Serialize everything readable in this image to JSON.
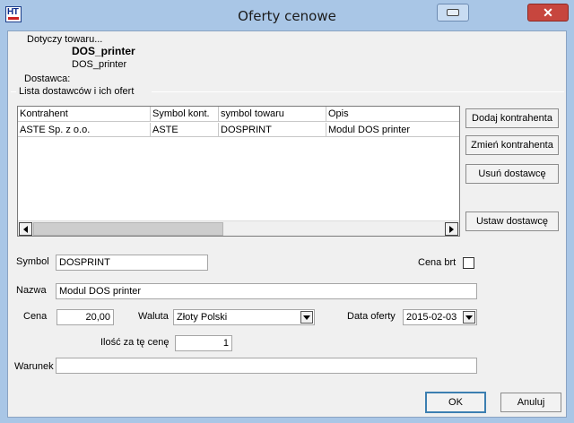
{
  "window": {
    "title": "Oferty cenowe",
    "app_icon_text": "HT",
    "close_glyph": "✕"
  },
  "product": {
    "label": "Dotyczy towaru...",
    "name_bold": "DOS_printer",
    "name": "DOS_printer",
    "supplier_label": "Dostawca:"
  },
  "offers_group": {
    "label": "Lista dostawców i ich ofert",
    "columns": [
      "Kontrahent",
      "Symbol kont.",
      "symbol towaru",
      "Opis"
    ],
    "rows": [
      [
        "ASTE Sp. z o.o.",
        "ASTE",
        "DOSPRINT",
        "Modul DOS printer"
      ]
    ]
  },
  "side_buttons": {
    "add": "Dodaj kontrahenta",
    "change": "Zmień kontrahenta",
    "remove": "Usuń dostawcę",
    "set": "Ustaw dostawcę"
  },
  "form": {
    "symbol_label": "Symbol",
    "symbol_value": "DOSPRINT",
    "gross_price_label": "Cena brt",
    "gross_price_checked": false,
    "name_label": "Nazwa",
    "name_value": "Modul DOS printer",
    "price_label": "Cena",
    "price_value": "20,00",
    "currency_label": "Waluta",
    "currency_value": "Złoty Polski",
    "offer_date_label": "Data oferty",
    "offer_date_value": "2015-02-03",
    "qty_label": "Ilość za tę cenę",
    "qty_value": "1",
    "condition_label": "Warunek",
    "condition_value": ""
  },
  "footer": {
    "ok": "OK",
    "cancel": "Anuluj"
  },
  "colors": {
    "titlebar": "#a9c6e6",
    "close_button": "#c7463e",
    "dialog_bg": "#f0f0f0",
    "default_button_border": "#3c7fb1"
  }
}
